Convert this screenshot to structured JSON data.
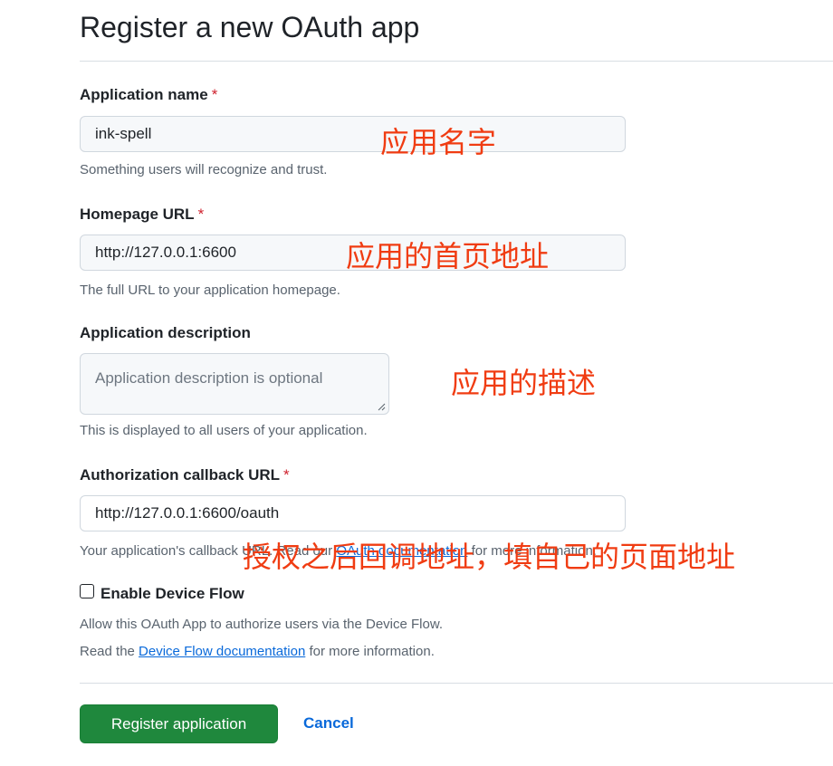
{
  "page": {
    "title": "Register a new OAuth app"
  },
  "fields": {
    "app_name": {
      "label": "Application name",
      "required_mark": "*",
      "value": "ink-spell",
      "hint": "Something users will recognize and trust."
    },
    "homepage_url": {
      "label": "Homepage URL",
      "required_mark": "*",
      "value": "http://127.0.0.1:6600",
      "hint": "The full URL to your application homepage."
    },
    "description": {
      "label": "Application description",
      "placeholder": "Application description is optional",
      "hint": "This is displayed to all users of your application."
    },
    "callback_url": {
      "label": "Authorization callback URL",
      "required_mark": "*",
      "value": "http://127.0.0.1:6600/oauth",
      "hint_prefix": "Your application's callback URL. Read our ",
      "hint_link": "OAuth documentation",
      "hint_suffix": " for more information."
    }
  },
  "device_flow": {
    "label": "Enable Device Flow",
    "checked": false,
    "hint_line1": "Allow this OAuth App to authorize users via the Device Flow.",
    "hint_prefix": "Read the ",
    "hint_link": "Device Flow documentation",
    "hint_suffix": " for more information."
  },
  "actions": {
    "register_label": "Register application",
    "cancel_label": "Cancel"
  },
  "annotations": {
    "app_name": "应用名字",
    "homepage": "应用的首页地址",
    "description": "应用的描述",
    "callback": "授权之后回调地址，填自己的页面地址"
  },
  "colors": {
    "primary_button": "#1f883d",
    "link": "#0969da",
    "required": "#cf222e",
    "annotation": "#f03c12"
  }
}
